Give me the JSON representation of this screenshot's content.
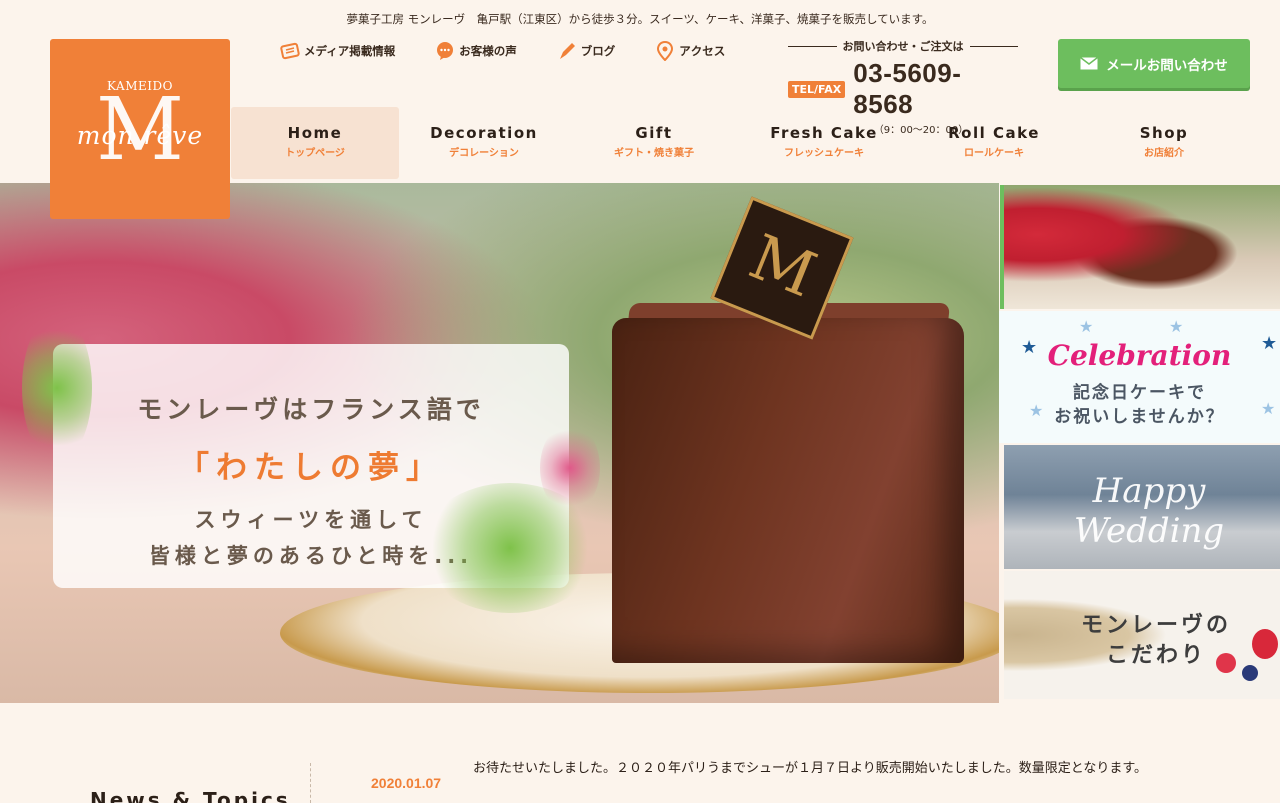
{
  "header": {
    "tagline": "夢菓子工房 モンレーヴ　亀戸駅（江東区）から徒歩３分。スイーツ、ケーキ、洋菓子、焼菓子を販売しています。",
    "logo": {
      "top_text": "KAMEIDO",
      "script_text": "mon rêve",
      "monogram": "M"
    },
    "util_nav": [
      {
        "label": "メディア掲載情報",
        "icon": "newspaper-icon"
      },
      {
        "label": "お客様の声",
        "icon": "speech-bubble-icon"
      },
      {
        "label": "ブログ",
        "icon": "pen-icon"
      },
      {
        "label": "アクセス",
        "icon": "map-pin-icon"
      }
    ],
    "contact": {
      "label": "お問い合わせ・ご注文は",
      "badge": "TEL/FAX",
      "number": "03-5609-8568",
      "hours": "（9：00〜20：00）"
    },
    "mail_button": "メールお問い合わせ"
  },
  "main_nav": [
    {
      "en": "Home",
      "ja": "トップページ",
      "active": true
    },
    {
      "en": "Decoration",
      "ja": "デコレーション"
    },
    {
      "en": "Gift",
      "ja": "ギフト・焼き菓子"
    },
    {
      "en": "Fresh Cake",
      "ja": "フレッシュケーキ"
    },
    {
      "en": "Roll Cake",
      "ja": "ロールケーキ"
    },
    {
      "en": "Shop",
      "ja": "お店紹介"
    }
  ],
  "hero": {
    "line1": "モンレーヴはフランス語で",
    "line2": "「わたしの夢」",
    "line3": "スウィーツを通して",
    "line4": "皆様と夢のあるひと時を...",
    "choco_mark": "M"
  },
  "side_banners": {
    "celebration_title": "Celebration",
    "celebration_sub1": "記念日ケーキで",
    "celebration_sub2": "お祝いしませんか？",
    "wedding": "Happy Wedding",
    "kodawari1": "モンレーヴの",
    "kodawari2": "こだわり"
  },
  "news": {
    "title": "News & Topics",
    "items": [
      {
        "date": "2020.01.07",
        "text": "お待たせいたしました。２０２０年パリうまでシューが１月７日より販売開始いたしました。数量限定となります。"
      }
    ]
  },
  "colors": {
    "accent": "#f08038",
    "green": "#6dbe5e",
    "text": "#3a2a1e"
  }
}
